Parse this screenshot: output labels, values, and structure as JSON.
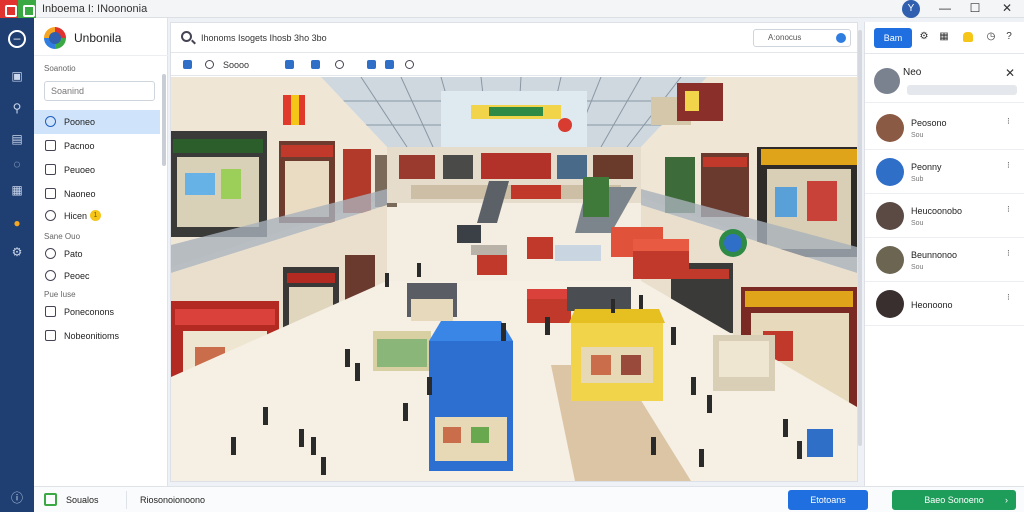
{
  "window": {
    "title": "Inboema I: INoononia",
    "user_initial": "Y",
    "minimize_glyph": "—",
    "maximize_glyph": "☐",
    "close_glyph": "✕"
  },
  "rail": {
    "icons": [
      "logo-icon",
      "home-icon",
      "search-icon",
      "inbox-icon",
      "chat-icon",
      "calendar-icon",
      "alert-icon",
      "settings-icon"
    ]
  },
  "sidebar": {
    "org_name": "Unbonila",
    "section_search": "Soanotio",
    "search_placeholder": "Soanind",
    "items": [
      {
        "label": "Pooneo",
        "icon": "clock-icon",
        "active": true
      },
      {
        "label": "Pacnoo",
        "icon": "document-icon",
        "active": false
      },
      {
        "label": "Peuoeo",
        "icon": "list-icon",
        "active": false
      },
      {
        "label": "Naoneo",
        "icon": "folder-icon",
        "active": false
      },
      {
        "label": "Hicen",
        "icon": "info-icon",
        "active": false,
        "badge": "1"
      }
    ],
    "section_two": "Sane Ouo",
    "items_two": [
      {
        "label": "Pato",
        "icon": "globe-icon"
      },
      {
        "label": "Peoec",
        "icon": "globe-icon"
      }
    ],
    "section_three": "Pue Iuse",
    "items_three": [
      {
        "label": "Poneconons",
        "icon": "grid-icon"
      },
      {
        "label": "Nobeonitioms",
        "icon": "square-icon"
      }
    ]
  },
  "main": {
    "search_text": "Ihonoms Isogets Ihosb 3ho 3bo",
    "search_box": "A:onocus",
    "toolbar_label": "Soooo"
  },
  "chat": {
    "primary_button": "Bam",
    "header_name": "Neo",
    "close_glyph": "✕",
    "contacts": [
      {
        "name": "Peosono",
        "sub": "Sou",
        "more": "⁝",
        "color": "#8a5a44"
      },
      {
        "name": "Peonny",
        "sub": "Sub",
        "more": "⁝",
        "color": "#2f6fc8"
      },
      {
        "name": "Heucoonobo",
        "sub": "Sou",
        "more": "⁝",
        "color": "#5b4a44"
      },
      {
        "name": "Beunnonoo",
        "sub": "Sou",
        "more": "⁝",
        "color": "#6b6552"
      },
      {
        "name": "Heonoono",
        "sub": "",
        "more": "⁝",
        "color": "#3a2f2f"
      }
    ]
  },
  "bottom": {
    "left_label": "Soualos",
    "status": "Riosonoionoono",
    "blue_button": "Etotoans",
    "green_button": "Baeo Sonoeno",
    "green_chevron": "›"
  },
  "colors": {
    "accent_blue": "#1f6fe0",
    "rail_navy": "#1f3f73",
    "accept_green": "#1e9d5a",
    "active_item": "#cfe3fb"
  }
}
